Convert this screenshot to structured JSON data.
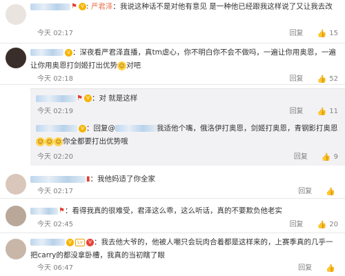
{
  "comments": [
    {
      "name": "严君泽",
      "text": "我说这种话不是对他有意见 是一种他已经跟我这样说了又让我去改",
      "time": "02:17",
      "reply": "回复",
      "likes": "15"
    },
    {
      "text": "深夜看严君泽直播，真tm虐心，你不明白你不会不做吗，一遍让你用奥恩，一遍让你用奥恩打剑姬打出优势",
      "text_after": "对吧",
      "time": "02:18",
      "reply": "回复",
      "likes": "52"
    },
    {
      "text": "对 就是这样",
      "time": "02:19",
      "reply": "回复",
      "likes": "11",
      "day": "今天"
    },
    {
      "reply_prefix": "回复@",
      "text": "我适他个嘴，俄洛伊打奥恩，剑姬打奥恩，青钢影打奥恩",
      "text_after": "你全都要打出优势哦",
      "time": "02:20",
      "reply": "回复",
      "likes": "9",
      "day": "今天"
    },
    {
      "text": "我他妈适了你全家",
      "time": "02:17",
      "reply": "回复",
      "likes": "",
      "day": "今天"
    },
    {
      "text": "看得我真的很难受，君泽这么乖，这么听话，真的不要欺负他老实",
      "time": "02:45",
      "reply": "回复",
      "likes": "20",
      "day": "今天"
    },
    {
      "text": "我去他大爷的，他被人嘲只会玩肉合着都是这样来的，上赛季真的几乎一把carry的都没拿卧槽，我真的当初瞎了眼",
      "time": "06:47",
      "reply": "回复",
      "likes": "",
      "day": "今天"
    }
  ],
  "day_label": "今天",
  "colors": {
    "accent": "#eb7350",
    "meta": "#808080",
    "sub_bg": "#f2f2f5"
  }
}
